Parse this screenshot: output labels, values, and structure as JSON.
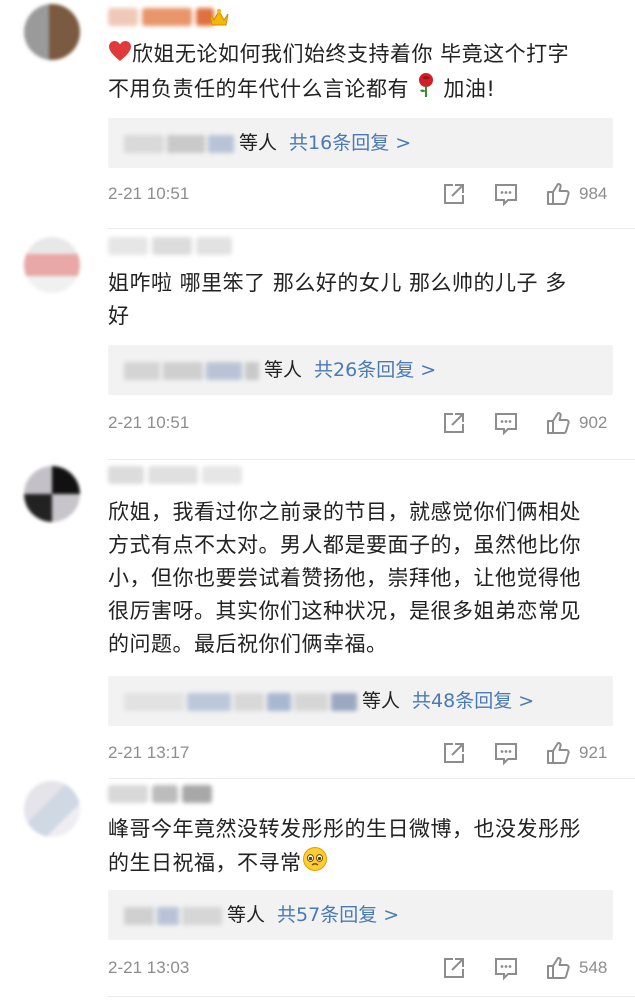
{
  "comments": [
    {
      "text_prefix_emoji": "heart-icon",
      "text_line1": "欣姐无论如何我们始终支持着你 毕竟这个打字",
      "text_line2a": "不用负责任的年代什么言论都有",
      "text_line2b": "加油!",
      "reply_suffix": "等人",
      "reply_link": "共16条回复 >",
      "time": "2-21 10:51",
      "likes": "984"
    },
    {
      "text_line1": "姐咋啦 哪里笨了 那么好的女儿 那么帅的儿子 多",
      "text_line2": "好",
      "reply_suffix": "等人",
      "reply_link": "共26条回复 >",
      "time": "2-21 10:51",
      "likes": "902"
    },
    {
      "text_line1": "欣姐，我看过你之前录的节目，就感觉你们俩相处",
      "text_line2": "方式有点不太对。男人都是要面子的，虽然他比你",
      "text_line3": "小，但你也要尝试着赞扬他，崇拜他，让他觉得他",
      "text_line4": "很厉害呀。其实你们这种状况，是很多姐弟恋常见",
      "text_line5": "的问题。最后祝你们俩幸福。",
      "reply_suffix": "等人",
      "reply_link": "共48条回复 >",
      "time": "2-21 13:17",
      "likes": "921"
    },
    {
      "text_line1": "峰哥今年竟然没转发彤彤的生日微博，也没发彤彤",
      "text_line2": "的生日祝福，不寻常",
      "reply_suffix": "等人",
      "reply_link": "共57条回复 >",
      "time": "2-21 13:03",
      "likes": "548"
    }
  ],
  "colors": {
    "link": "#4a79b5",
    "meta": "#8d8d8d",
    "reply_bg": "#f2f2f2"
  }
}
